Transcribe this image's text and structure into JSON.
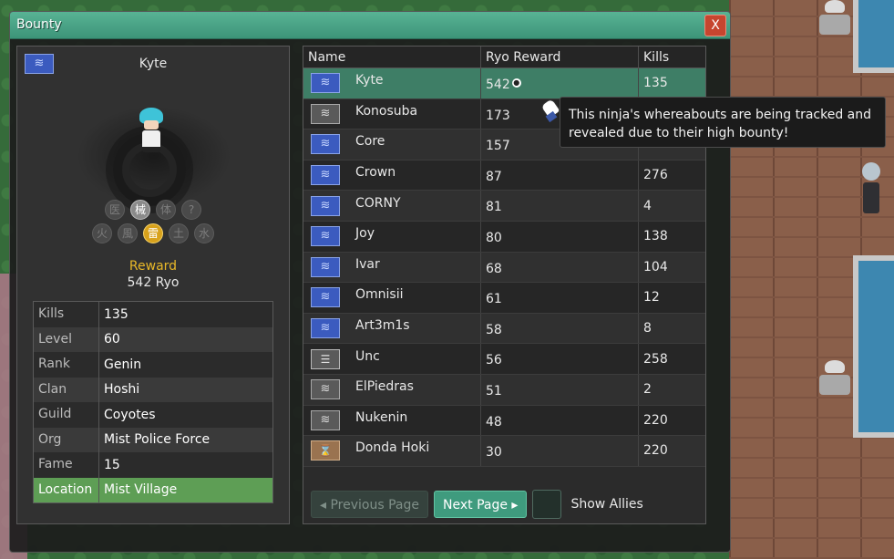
{
  "window": {
    "title": "Bounty",
    "close_label": "X"
  },
  "profile": {
    "name": "Kyte",
    "reward_label": "Reward",
    "reward_value": "542 Ryo",
    "elements_top": [
      "医",
      "械",
      "体",
      "?"
    ],
    "elements_bottom": [
      "火",
      "風",
      "雷",
      "土",
      "水"
    ],
    "stats": [
      {
        "key": "Kills",
        "value": "135"
      },
      {
        "key": "Level",
        "value": "60"
      },
      {
        "key": "Rank",
        "value": "Genin"
      },
      {
        "key": "Clan",
        "value": "Hoshi"
      },
      {
        "key": "Guild",
        "value": "Coyotes"
      },
      {
        "key": "Org",
        "value": "Mist Police Force"
      },
      {
        "key": "Fame",
        "value": "15"
      },
      {
        "key": "Location",
        "value": "Mist Village"
      }
    ]
  },
  "table": {
    "headers": {
      "name": "Name",
      "ryo": "Ryo Reward",
      "kills": "Kills"
    },
    "rows": [
      {
        "name": "Kyte",
        "ryo": "542",
        "kills": "135",
        "flag": "blue"
      },
      {
        "name": "Konosuba",
        "ryo": "173",
        "kills": "",
        "flag": "grey"
      },
      {
        "name": "Core",
        "ryo": "157",
        "kills": "3",
        "flag": "blue"
      },
      {
        "name": "Crown",
        "ryo": "87",
        "kills": "276",
        "flag": "blue"
      },
      {
        "name": "CORNY",
        "ryo": "81",
        "kills": "4",
        "flag": "blue"
      },
      {
        "name": "Joy",
        "ryo": "80",
        "kills": "138",
        "flag": "blue"
      },
      {
        "name": "Ivar",
        "ryo": "68",
        "kills": "104",
        "flag": "blue"
      },
      {
        "name": "Omnisii",
        "ryo": "61",
        "kills": "12",
        "flag": "blue"
      },
      {
        "name": "Art3m1s",
        "ryo": "58",
        "kills": "8",
        "flag": "blue"
      },
      {
        "name": "Unc",
        "ryo": "56",
        "kills": "258",
        "flag": "mist"
      },
      {
        "name": "ElPiedras",
        "ryo": "51",
        "kills": "2",
        "flag": "grey"
      },
      {
        "name": "Nukenin",
        "ryo": "48",
        "kills": "220",
        "flag": "grey"
      },
      {
        "name": "Donda Hoki",
        "ryo": "30",
        "kills": "220",
        "flag": "brown"
      }
    ]
  },
  "pager": {
    "prev_label": "◂ Previous Page",
    "next_label": "Next Page ▸",
    "show_allies_label": "Show Allies"
  },
  "tooltip": {
    "line1": "This ninja's whereabouts are being tracked and",
    "line2": "revealed due to their high bounty!"
  },
  "colors": {
    "accent": "#3f9b7e",
    "gold": "#e8b828",
    "selected_row": "#3e7e66",
    "close": "#c6452f"
  },
  "icons": {
    "tracked": "eye-icon",
    "cursor": "hand-cursor-icon"
  }
}
